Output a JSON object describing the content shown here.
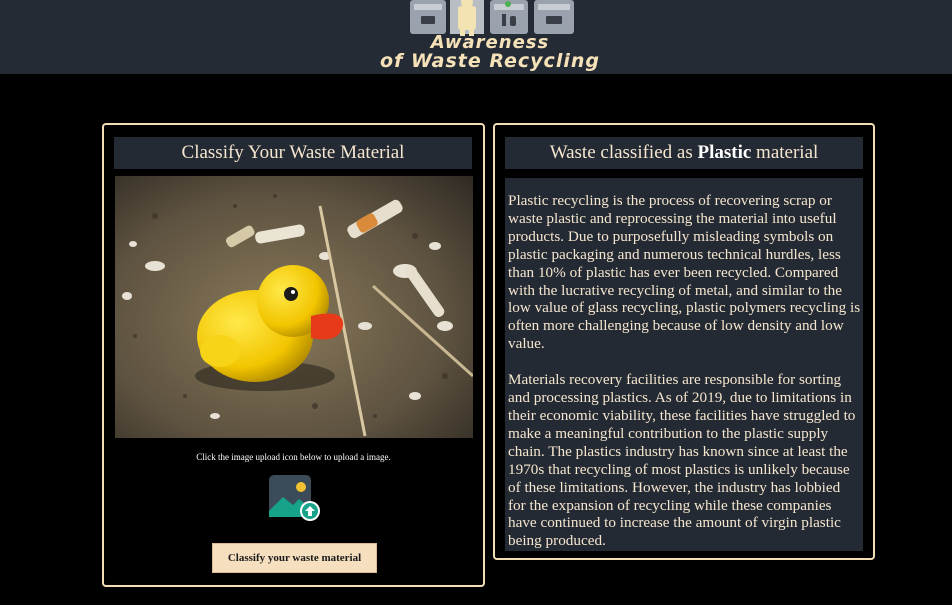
{
  "header": {
    "logo_line1": "Awareness",
    "logo_line2": "of Waste Recycling",
    "logo_icon": "recycling-bins-person-logo"
  },
  "left_panel": {
    "title": "Classify Your Waste Material",
    "image_alt": "rubber duck on beach litter",
    "hint": "Click the image upload icon below to upload a image.",
    "upload_icon": "image-upload-icon",
    "button_label": "Classify your waste material"
  },
  "right_panel": {
    "title_prefix": "Waste classified as ",
    "title_material": "Plastic",
    "title_suffix": " material",
    "paragraphs": [
      "Plastic recycling is the process of recovering scrap or waste plastic and reprocessing the material into useful products. Due to purposefully misleading symbols on plastic packaging and numerous technical hurdles, less than 10% of plastic has ever been recycled. Compared with the lucrative recycling of metal, and similar to the low value of glass recycling, plastic polymers recycling is often more challenging because of low density and low value.",
      "Materials recovery facilities are responsible for sorting and processing plastics. As of 2019, due to limitations in their economic viability, these facilities have struggled to make a meaningful contribution to the plastic supply chain. The plastics industry has known since at least the 1970s that recycling of most plastics is unlikely because of these limitations. However, the industry has lobbied for the expansion of recycling while these companies have continued to increase the amount of virgin plastic being produced."
    ]
  },
  "colors": {
    "accent": "#f3ddb5",
    "header_bg": "#252b35",
    "panel_bg": "#242a33"
  }
}
